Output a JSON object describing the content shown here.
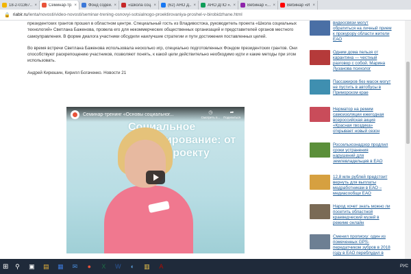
{
  "browser": {
    "tabs": [
      {
        "label": "18-2-01367...",
        "color": "#f2b500",
        "active": false
      },
      {
        "label": "Семинар-тр...",
        "color": "#e8533a",
        "active": true
      },
      {
        "label": "Фонд содей...",
        "color": "#3c78d8",
        "active": false
      },
      {
        "label": "«Школа соц...",
        "color": "#c62828",
        "active": false
      },
      {
        "label": "(62) АНО Д...",
        "color": "#1877f2",
        "active": false
      },
      {
        "label": "АНО ДПО «...",
        "color": "#0f9d58",
        "active": false
      },
      {
        "label": "Вебинар «...",
        "color": "#8e24aa",
        "active": false
      },
      {
        "label": "Вебинар «И...",
        "color": "#ff0000",
        "active": false
      }
    ],
    "url_host": "riabir.ru",
    "url_path": "/lenta/novosti/video-novosti/seminar-trening-osnovyi-sotsialnogo-proektirovaniya-proshel-v-birobidzhane.html"
  },
  "article": {
    "paragraphs": [
      "президентских грантов прошел в областном центре. Специальный гость из Владивостока, руководитель проекта «Школа социальных технологий» Светлана Баженова, провела его для некоммерческих общественных организаций и представителей органов местного самоуправления. В форме диалога участники обсудили наилучшие стратегии и пути достижения поставленных целей.",
      "Во время встречи Светлана Баженова использовала несколько игр, специально подготовленных Фондом президентских грантов. Они способствуют раскрепощению участников, позволяют понять, к какой цели действительно необходимо идти и какие методы при этом использовать.",
      "Андрей Кирюшин, Кирилл Богаченко. Новости 21"
    ]
  },
  "video": {
    "title": "Семинар-тренинг «Основы социальног...",
    "slide_text": "Социальное проектирование: от идеи к проекту",
    "watch_later_label": "Смотреть п...",
    "share_label": "Поделиться"
  },
  "sidebar": {
    "news": [
      {
        "text": "видеосвязи могут обратиться на личный прием к прокурору области жители ЕАО",
        "thumb": "#4a6fa5"
      },
      {
        "text": "Одним дома пельзя от карантина — честный разговор с собой. Марина Лузанова психолог",
        "thumb": "#b53a3a"
      },
      {
        "text": "Пассажиров без масок могут не пустить в автобусы в Приморском крае",
        "thumb": "#3f8fb0"
      },
      {
        "text": "Нерматор на ремим самоизоляции ежегодная всероссийская акция «Красная гвоздика» открывает новый сезон",
        "thumb": "#c94c5a"
      },
      {
        "text": "Россельхознадзор продлил сроки устранения нарушений для землевладельцев в ЕАО",
        "thumb": "#5b8f3a"
      },
      {
        "text": "12,8 млн рублей предстоит вернуть для выплаты медработникам в ЕАО – медиасообщи ЕАО",
        "thumb": "#d6a040"
      },
      {
        "text": "Народ хочет знать можно ли посетить областной краеведческий музей в режиме онлайн",
        "thumb": "#7a6a55"
      },
      {
        "text": "Сменил прописку: один из помеченных GPS-передатчиком зубров в 2018 году в ЕАО переблудил в",
        "thumb": "#6d7f93"
      }
    ]
  },
  "taskbar": {
    "items": [
      "search",
      "task-view",
      "files",
      "store",
      "mail",
      "chrome",
      "excel",
      "word",
      "photos",
      "explorer",
      "acrobat"
    ],
    "lang": "РУС"
  }
}
